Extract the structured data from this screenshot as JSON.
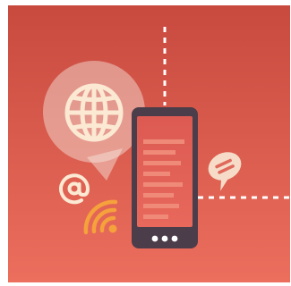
{
  "illustration": {
    "background_top": "#c84a3f",
    "background_bottom": "#ec6e5d",
    "phone_body": "#4b3d4a",
    "phone_screen": "#e05f55",
    "screen_lines": "#f08a78",
    "bubble_fill": "#f6dcc8",
    "globe_bubble_fill": "#f7ece3",
    "icon_cream": "#fbe9d3",
    "wifi_color": "#f5a13c",
    "dashed_line": "#ffffff"
  },
  "icons": [
    "globe-icon",
    "at-sign-icon",
    "wifi-signal-icon",
    "chat-bubble-icon",
    "smartphone-icon"
  ]
}
